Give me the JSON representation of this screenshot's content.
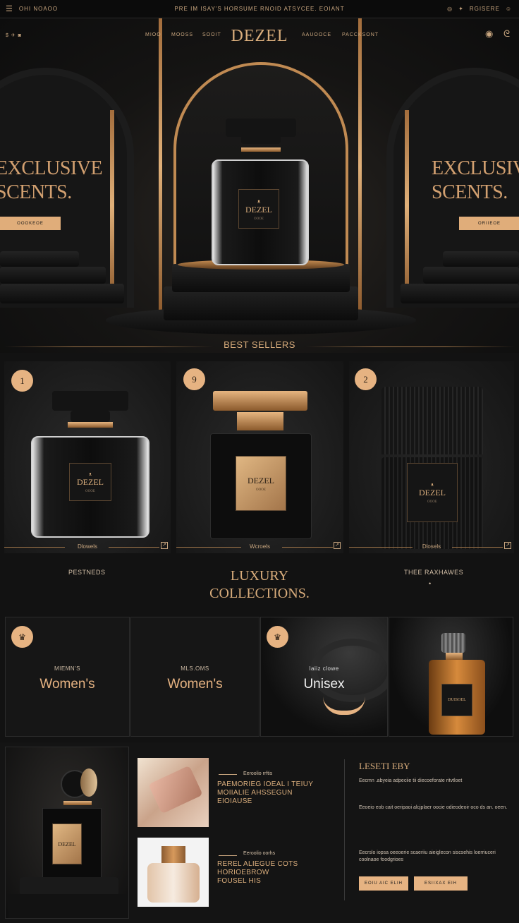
{
  "topbar": {
    "left_text": "OHI NOAOO",
    "center_text": "PRE IM ISAY'S HORSUME RNOID ATSYCEE. EOIANT",
    "right_text": "RGISERE"
  },
  "nav": {
    "items": [
      "MIOO",
      "MOOSS",
      "SOOIT"
    ],
    "items_right": [
      "AAUOOCE",
      "PACCKSONT"
    ],
    "logo": "DEZEL"
  },
  "hero": {
    "left_title_1": "EXCLUSIVE",
    "left_title_2": "SCENTS.",
    "left_button": "OOOKEOE",
    "right_title_1": "EXCLUSIVE",
    "right_title_2": "SCENTS.",
    "right_button": "ORIIEOE",
    "bottle_label": "DEZEL",
    "bottle_label_small": "OOOE",
    "bottle_emblem": "ᴥ"
  },
  "best_sellers": {
    "title": "BEST SELLERS",
    "cards": [
      {
        "rank": "1",
        "label": "DEZEL",
        "sub": "OOOE",
        "footer": "Dlowels"
      },
      {
        "rank": "9",
        "label": "DEZEL",
        "sub": "OOOE",
        "footer": "Wcroels"
      },
      {
        "rank": "2",
        "label": "DEZEL",
        "sub": "OOOE",
        "footer": "Dlosels"
      }
    ]
  },
  "collections": {
    "left_head": "PESTNEDS",
    "title_1": "LUXURY",
    "title_2": "COLLECTIONS.",
    "right_head": "THEE RAXHAWES",
    "right_sub": "•",
    "cells": [
      {
        "small": "MIEMN'S",
        "big": "Women's"
      },
      {
        "small": "MLS.OMS",
        "big": "Women's"
      },
      {
        "small": "Iaiiz clowe",
        "big": "Unisex"
      }
    ],
    "bottle_label": "DUISOEL"
  },
  "bottom": {
    "promo_label": "DEZEL",
    "item1_sub": "Eeroolio rrftis",
    "item1_title": [
      "PAEMORIEG IOEAL I TEIUY",
      "MOIIALIE AHSSEGUN",
      "EIOIAUSE"
    ],
    "item2_sub": "Eeroolio oorhs",
    "item2_title": [
      "REREL ALIEGUE COTS",
      "HORIOEBROW",
      "FOUSEL HIS"
    ],
    "right_title": "LESETI EBY",
    "right_text_1": "Eecmn .abyeia adpeciie tii diecoeforate ritvtloet",
    "right_text_2": "Eeoeio eob cait oeripaoi alcjplaer oocie odieodeoir oco ds an. oeen.",
    "right_text_3": "Eecrslo iopsa oeeoerie scaeriiu aieiglecon siscsehis loerriuceri coolnaoe foodgrioes",
    "btn1": "EOIU AIC ELIH",
    "btn2": "ESIIXAX EIH"
  }
}
